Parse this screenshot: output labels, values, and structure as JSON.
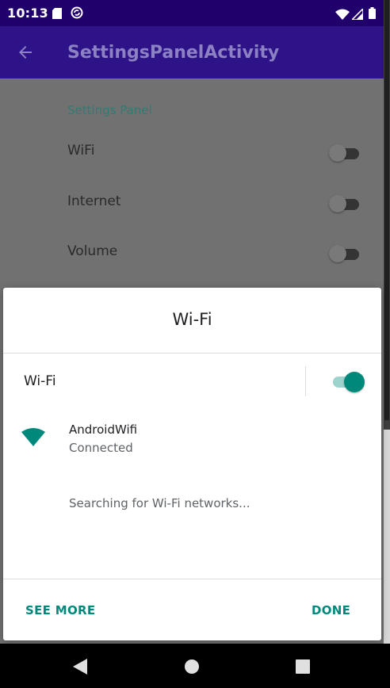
{
  "status_bar": {
    "time": "10:13"
  },
  "app_bar": {
    "title": "SettingsPanelActivity"
  },
  "settings": {
    "section_header": "Settings Panel",
    "items": [
      {
        "label": "WiFi",
        "enabled": false
      },
      {
        "label": "Internet",
        "enabled": false
      },
      {
        "label": "Volume",
        "enabled": false
      }
    ]
  },
  "panel": {
    "title": "Wi-Fi",
    "toggle_label": "Wi-Fi",
    "toggle_on": true,
    "network": {
      "ssid": "AndroidWifi",
      "status": "Connected"
    },
    "searching_text": "Searching for Wi-Fi networks...",
    "see_more_label": "SEE MORE",
    "done_label": "DONE"
  },
  "colors": {
    "status_bar": "#20006a",
    "app_bar": "#2e1287",
    "accent": "#00897b"
  },
  "icons": [
    "back-arrow-icon",
    "sd-card-icon",
    "sync-icon",
    "wifi-status-icon",
    "cell-signal-icon",
    "battery-icon",
    "wifi-network-icon",
    "nav-back-icon",
    "nav-home-icon",
    "nav-recents-icon"
  ]
}
